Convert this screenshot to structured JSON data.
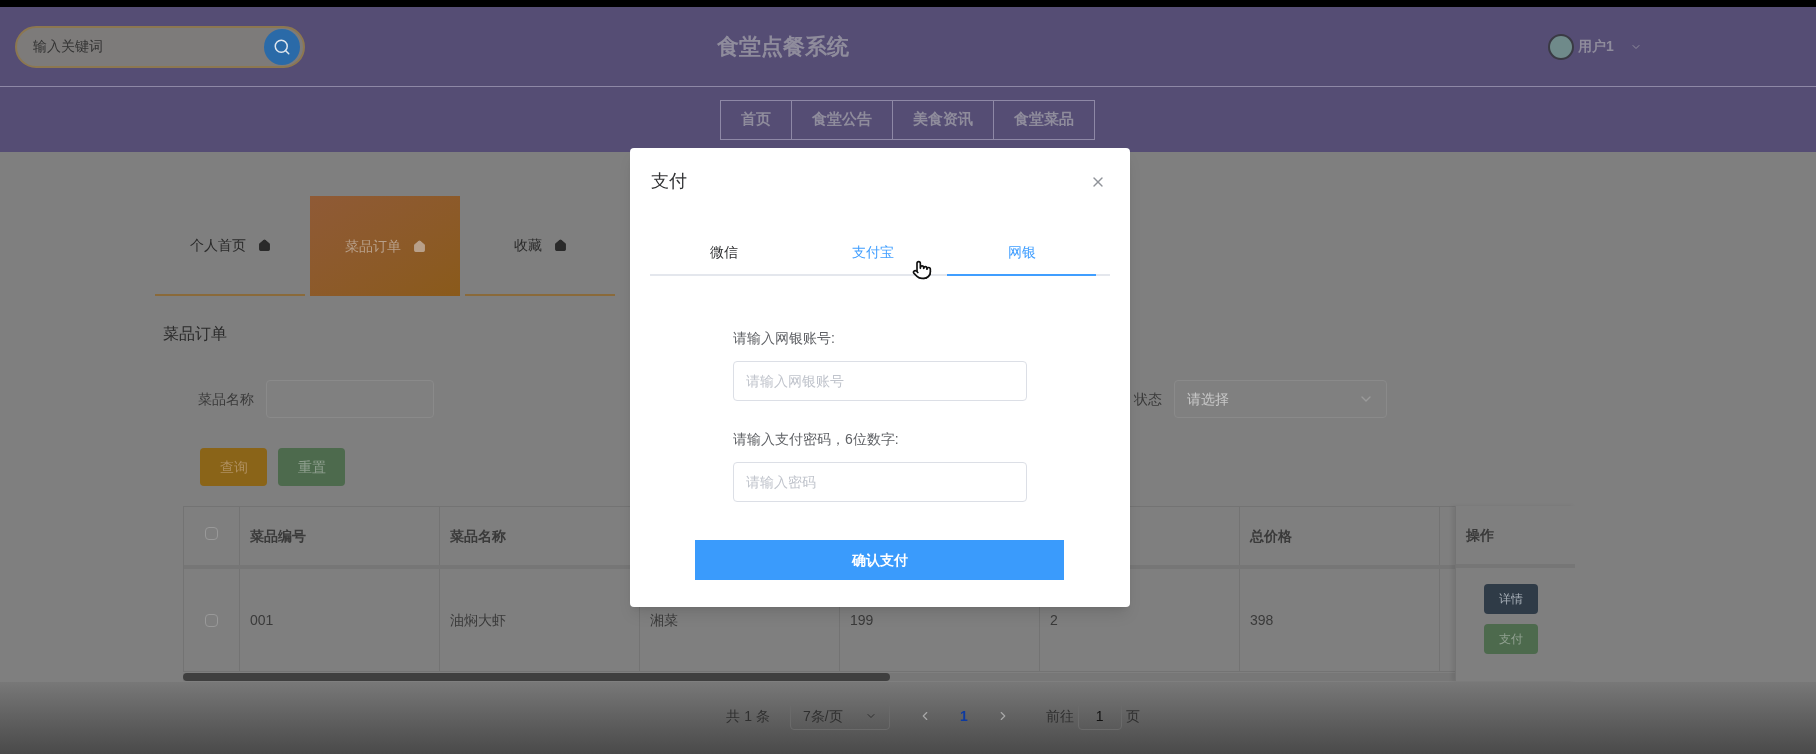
{
  "header": {
    "search": {
      "placeholder": "输入关键词"
    },
    "title": "食堂点餐系统",
    "user": {
      "name": "用户1"
    }
  },
  "nav": [
    {
      "label": "首页"
    },
    {
      "label": "食堂公告"
    },
    {
      "label": "美食资讯"
    },
    {
      "label": "食堂菜品"
    }
  ],
  "profile_tabs": [
    {
      "label": "个人首页",
      "selected": false
    },
    {
      "label": "菜品订单",
      "selected": true
    },
    {
      "label": "收藏",
      "selected": false
    }
  ],
  "section_title": "菜品订单",
  "filters": [
    {
      "label": "菜品名称",
      "kind": "input"
    },
    {
      "label": "状态",
      "kind": "select",
      "placeholder": "请选择"
    }
  ],
  "filter_buttons": [
    {
      "label": "查询",
      "kind": "primary"
    },
    {
      "label": "重置",
      "kind": "secondary"
    }
  ],
  "table": {
    "header_checked": false,
    "columns": [
      "菜品编号",
      "菜品名称",
      "",
      "",
      "",
      "总价格"
    ],
    "action_column": "操作",
    "rows": [
      {
        "checked": false,
        "cells": [
          "001",
          "油焖大虾",
          "湘菜",
          "199",
          "2",
          "398"
        ],
        "actions": [
          {
            "label": "详情",
            "kind": "detail"
          },
          {
            "label": "支付",
            "kind": "pay"
          }
        ]
      }
    ]
  },
  "pagination": {
    "total": "共 1 条",
    "page_size": "7条/页",
    "pages": [
      {
        "label": "1",
        "selected": true
      }
    ],
    "goto_label": "前往",
    "goto_value": "1",
    "goto_suffix": "页"
  },
  "dialog": {
    "title": "支付",
    "tabs": [
      {
        "label": "微信",
        "selected": false
      },
      {
        "label": "支付宝",
        "selected": false,
        "hovered": true
      },
      {
        "label": "网银",
        "selected": true
      }
    ],
    "fields": [
      {
        "label": "请输入网银账号:",
        "placeholder": "请输入网银账号"
      },
      {
        "label": "请输入支付密码，6位数字:",
        "placeholder": "请输入密码"
      }
    ],
    "confirm": "确认支付"
  }
}
